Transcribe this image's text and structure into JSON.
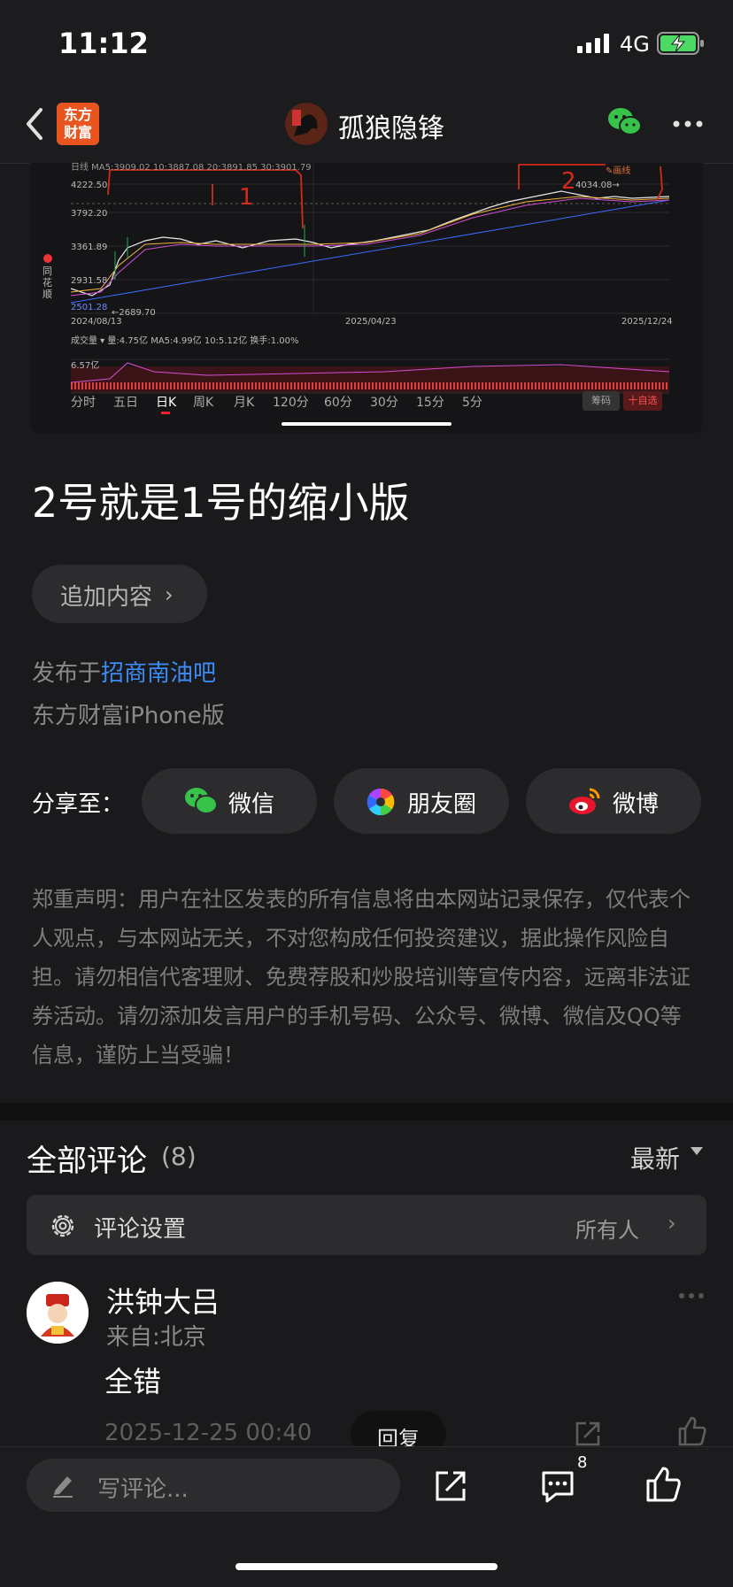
{
  "status": {
    "time": "11:12",
    "network": "4G"
  },
  "header": {
    "logo_line1": "东方",
    "logo_line2": "财富",
    "author": "孤狼隐锋",
    "avatar_text": "孤狼"
  },
  "chart": {
    "ma_line": "日线  MA5:3909.02  10:3887.08  20:3891.85  30:3901.79",
    "y_ticks": [
      "4222.50",
      "3792.20",
      "3361.89",
      "2931.58",
      "2501.28"
    ],
    "low_label": "←2689.70",
    "high_label": "4034.08→",
    "draw_label": "✎画线",
    "x_ticks": [
      "2024/08/13",
      "2025/04/23",
      "2025/12/24"
    ],
    "vol_header": "成交量 ▾  量:4.75亿  MA5:4.99亿  10:5.12亿  换手:1.00%",
    "vol_tick": "6.57亿",
    "side_brand": "同花顺",
    "annot_1": "1",
    "annot_2": "2",
    "tabs": [
      "分时",
      "五日",
      "日K",
      "周K",
      "月K",
      "120分",
      "60分",
      "30分",
      "15分",
      "5分"
    ],
    "btn_chouma": "筹码",
    "btn_zixuan": "十自选"
  },
  "post": {
    "title": "2号就是1号的缩小版",
    "append_label": "追加内容",
    "published_prefix": "发布于",
    "bar_name": "招商南油吧",
    "device": "东方财富iPhone版"
  },
  "share": {
    "label": "分享至：",
    "wechat": "微信",
    "moments": "朋友圈",
    "weibo": "微博"
  },
  "disclaimer": "郑重声明：用户在社区发表的所有信息将由本网站记录保存，仅代表个人观点，与本网站无关，不对您构成任何投资建议，据此操作风险自担。请勿相信代客理财、免费荐股和炒股培训等宣传内容，远离非法证券活动。请勿添加发言用户的手机号码、公众号、微博、微信及QQ等信息，谨防上当受骗！",
  "comments": {
    "title": "全部评论",
    "count": "(8)",
    "sort": "最新",
    "settings_label": "评论设置",
    "settings_value": "所有人",
    "items": [
      {
        "user": "洪钟大吕",
        "location": "来自:北京",
        "text": "全错",
        "date": "2025-12-25 00:40",
        "reply_label": "回复"
      }
    ]
  },
  "bottom": {
    "placeholder": "写评论...",
    "comment_count": "8"
  }
}
